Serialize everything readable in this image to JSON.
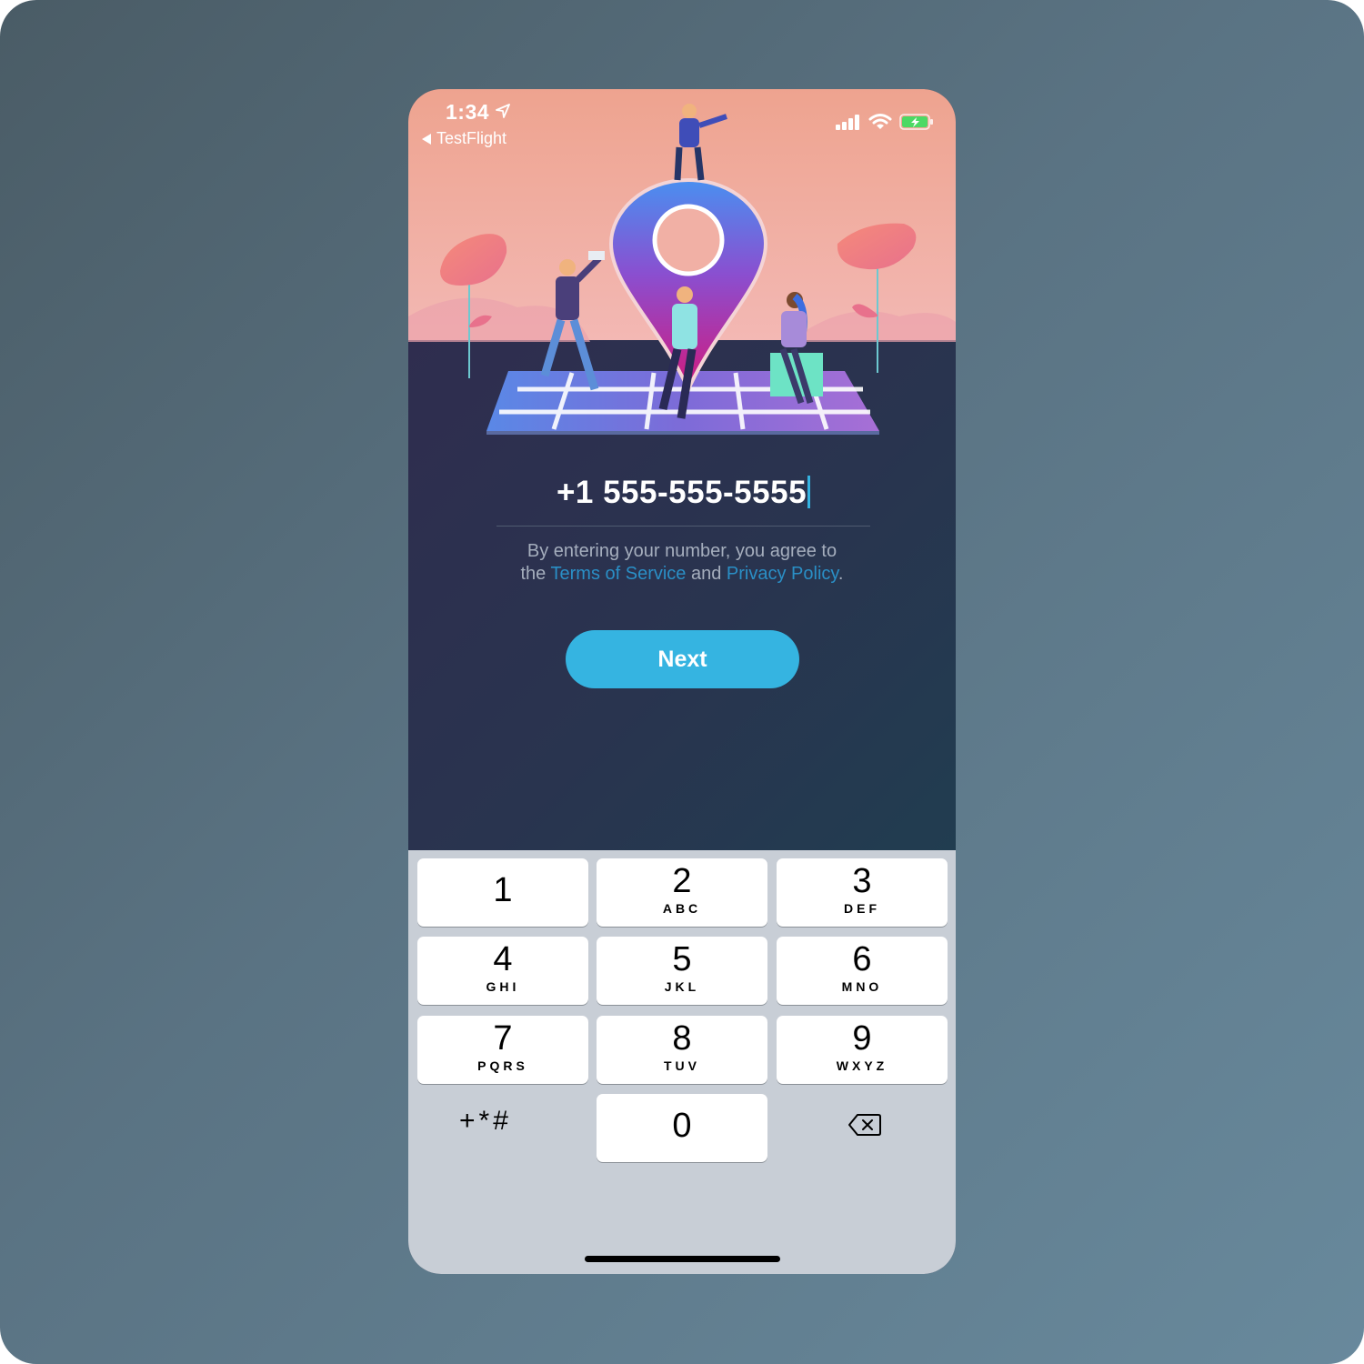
{
  "status_bar": {
    "time": "1:34",
    "back_app": "TestFlight"
  },
  "form": {
    "phone_value": "+1 555-555-5555",
    "terms": {
      "part1": "By entering your number, you agree to the ",
      "tos_link": "Terms of Service",
      "part2": " and ",
      "privacy_link": "Privacy Policy",
      "part3": "."
    },
    "next_label": "Next"
  },
  "keypad": {
    "keys": [
      {
        "num": "1",
        "letters": ""
      },
      {
        "num": "2",
        "letters": "ABC"
      },
      {
        "num": "3",
        "letters": "DEF"
      },
      {
        "num": "4",
        "letters": "GHI"
      },
      {
        "num": "5",
        "letters": "JKL"
      },
      {
        "num": "6",
        "letters": "MNO"
      },
      {
        "num": "7",
        "letters": "PQRS"
      },
      {
        "num": "8",
        "letters": "TUV"
      },
      {
        "num": "9",
        "letters": "WXYZ"
      },
      {
        "num": "0",
        "letters": ""
      }
    ],
    "symbols_label": "+*#"
  },
  "colors": {
    "accent": "#35b4e1",
    "link": "#2a8fc6",
    "sky_top": "#eea38f",
    "background_dark": "#2b3049",
    "keyboard_bg": "#c8ced6"
  },
  "icons": [
    "location-arrow-icon",
    "back-chevron-icon",
    "signal-icon",
    "wifi-icon",
    "battery-charging-icon",
    "delete-backspace-icon"
  ]
}
